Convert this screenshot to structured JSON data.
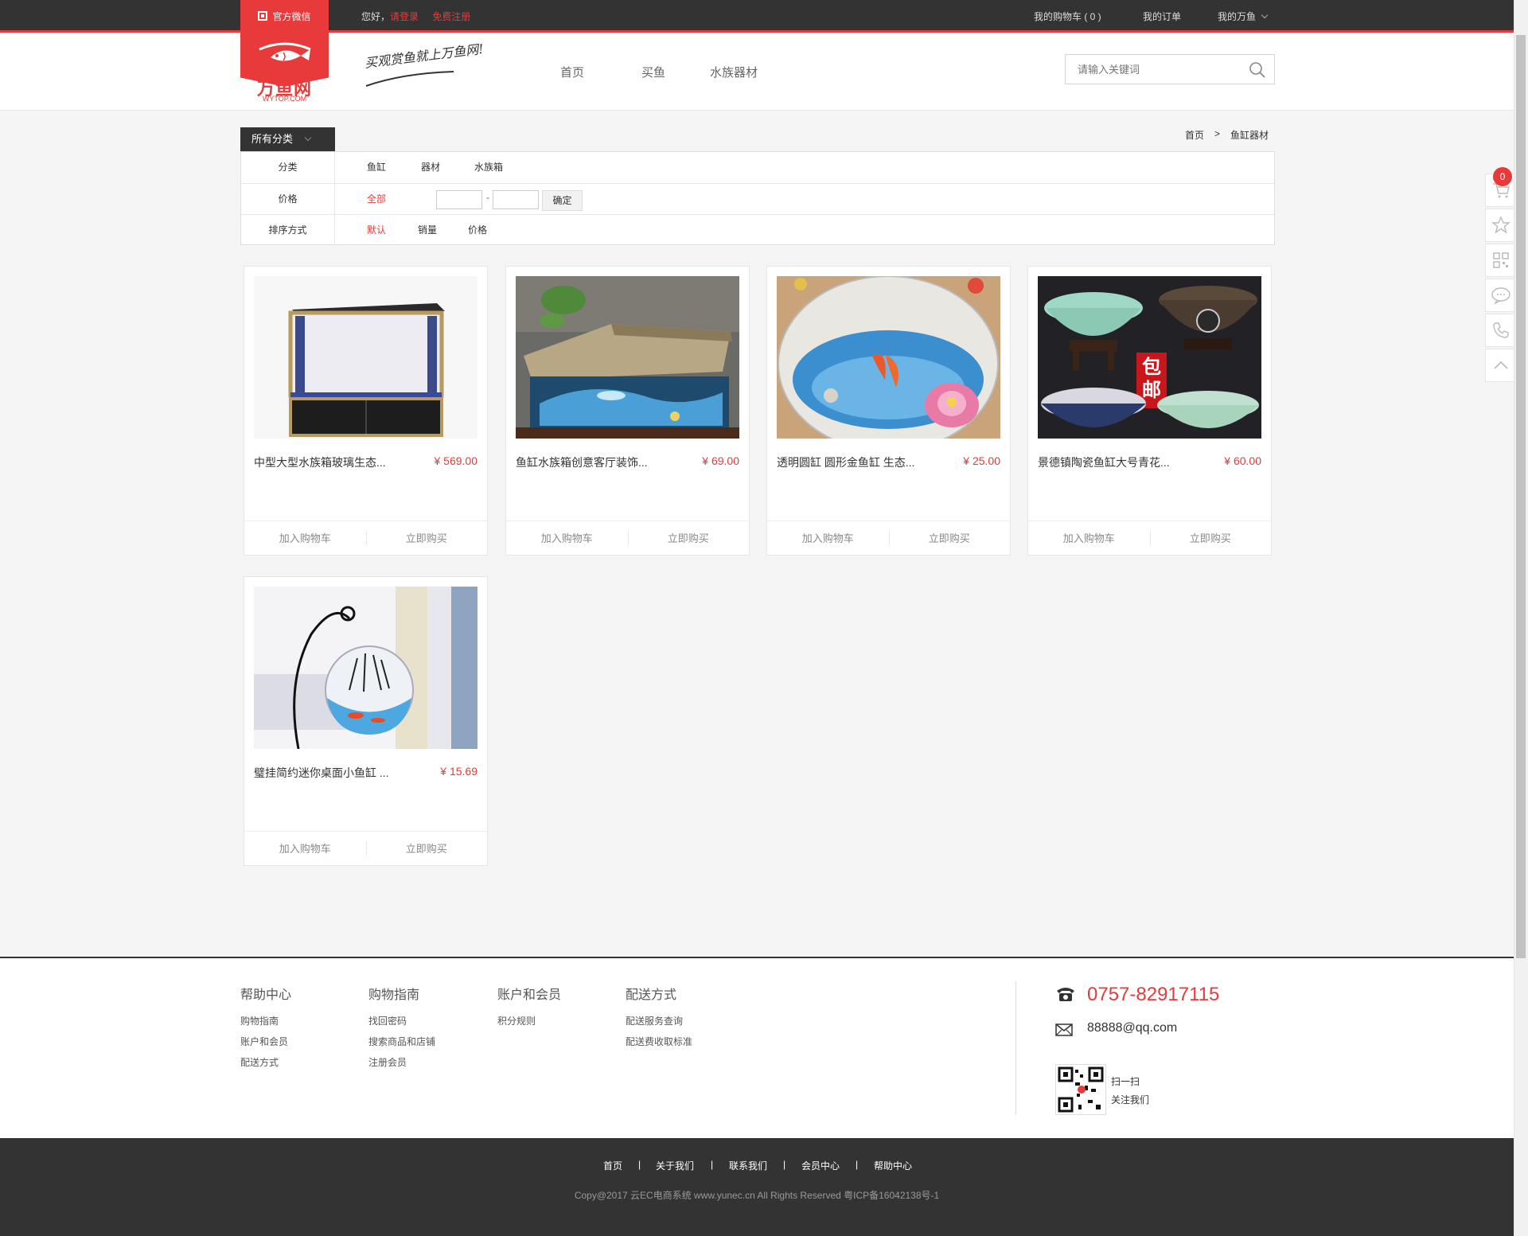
{
  "topbar": {
    "weixin": "官方微信",
    "greeting": "您好，",
    "login": "请登录",
    "register": "免费注册",
    "cart": "我的购物车 ( 0 )",
    "orders": "我的订单",
    "my_account": "我的万鱼"
  },
  "header": {
    "logo_name": "万鱼网",
    "logo_domain": "WYTOP.COM",
    "slogan": "买观赏鱼就上万鱼网!",
    "nav": [
      "首页",
      "买鱼",
      "水族器材"
    ],
    "search_placeholder": "请输入关键词"
  },
  "category": {
    "button": "所有分类",
    "breadcrumb_home": "首页",
    "breadcrumb_sep": ">",
    "breadcrumb_current": "鱼缸器材"
  },
  "filters": {
    "category_label": "分类",
    "category_options": [
      "鱼缸",
      "器材",
      "水族箱"
    ],
    "price_label": "价格",
    "price_all": "全部",
    "price_dash": "-",
    "confirm": "确定",
    "sort_label": "排序方式",
    "sort_options": [
      "默认",
      "销量",
      "价格"
    ]
  },
  "products": [
    {
      "title": "中型大型水族箱玻璃生态...",
      "price": "¥ 569.00"
    },
    {
      "title": "鱼缸水族箱创意客厅装饰...",
      "price": "¥ 69.00"
    },
    {
      "title": "透明圆缸 圆形金鱼缸 生态...",
      "price": "¥ 25.00"
    },
    {
      "title": "景德镇陶瓷鱼缸大号青花...",
      "price": "¥ 60.00",
      "badge_top": "包",
      "badge_bottom": "邮"
    },
    {
      "title": "璧挂简约迷你桌面小鱼缸 ...",
      "price": "¥ 15.69"
    }
  ],
  "product_actions": {
    "add_cart": "加入购物车",
    "buy_now": "立即购买"
  },
  "sidebar": {
    "cart_count": "0",
    "icons": [
      "cart-icon",
      "star-icon",
      "qrcode-icon",
      "chat-icon",
      "phone-icon",
      "back-to-top-icon"
    ]
  },
  "footer": {
    "columns": [
      {
        "title": "帮助中心",
        "items": [
          "购物指南",
          "账户和会员",
          "配送方式"
        ]
      },
      {
        "title": "购物指南",
        "items": [
          "找回密码",
          "搜索商品和店铺",
          "注册会员"
        ]
      },
      {
        "title": "账户和会员",
        "items": [
          "积分规则"
        ]
      },
      {
        "title": "配送方式",
        "items": [
          "配送服务查询",
          "配送费收取标准"
        ]
      }
    ],
    "phone": "0757-82917115",
    "email": "88888@qq.com",
    "scan_line1": "扫一扫",
    "scan_line2": "关注我们"
  },
  "bottom": {
    "links": [
      "首页",
      "关于我们",
      "联系我们",
      "会员中心",
      "帮助中心"
    ],
    "separator": "|",
    "copyright": "Copy@2017 云EC电商系统 www.yunec.cn All Rights Reserved 粤ICP备16042138号-1"
  },
  "colors": {
    "accent": "#e83a3a",
    "dark": "#333333"
  }
}
